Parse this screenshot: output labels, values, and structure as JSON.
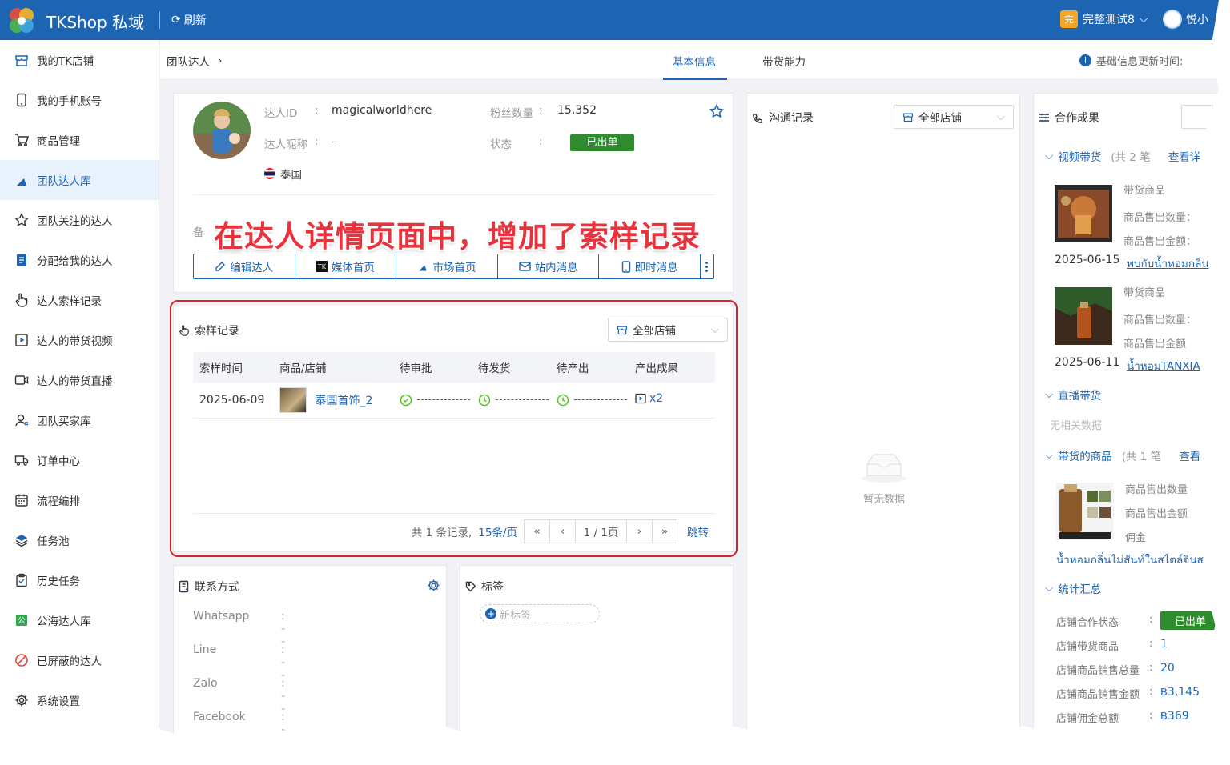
{
  "app": {
    "title": "TKShop 私域",
    "refresh": "刷新",
    "team": "完整测试8",
    "team_badge": "完",
    "user": "悦小"
  },
  "sidebar": {
    "items": [
      {
        "label": "我的TK店铺",
        "icon": "shop-icon"
      },
      {
        "label": "我的手机账号",
        "icon": "phone-icon"
      },
      {
        "label": "商品管理",
        "icon": "cart-icon"
      },
      {
        "label": "团队达人库",
        "icon": "creator-library-icon",
        "active": true
      },
      {
        "label": "团队关注的达人",
        "icon": "star-icon"
      },
      {
        "label": "分配给我的达人",
        "icon": "assigned-doc-icon"
      },
      {
        "label": "达人索样记录",
        "icon": "hand-pointer-icon"
      },
      {
        "label": "达人的带货视频",
        "icon": "video-play-icon"
      },
      {
        "label": "达人的带货直播",
        "icon": "live-camera-icon"
      },
      {
        "label": "团队买家库",
        "icon": "buyer-user-icon"
      },
      {
        "label": "订单中心",
        "icon": "truck-icon"
      },
      {
        "label": "流程编排",
        "icon": "calendar-icon"
      },
      {
        "label": "任务池",
        "icon": "layers-icon"
      },
      {
        "label": "历史任务",
        "icon": "clipboard-check-icon"
      },
      {
        "label": "公海达人库",
        "icon": "public-pool-icon"
      },
      {
        "label": "已屏蔽的达人",
        "icon": "blocked-icon"
      },
      {
        "label": "系统设置",
        "icon": "gear-icon"
      }
    ]
  },
  "header": {
    "breadcrumb": "团队达人",
    "tabs": [
      "基本信息",
      "带货能力"
    ],
    "update_label": "基础信息更新时间:"
  },
  "profile": {
    "id_label": "达人ID",
    "id_value": "magicalworldhere",
    "fans_label": "粉丝数量",
    "fans_value": "15,352",
    "nick_label": "达人昵称",
    "nick_value": "--",
    "status_label": "状态",
    "status_value": "已出单",
    "region": "泰国",
    "colon": ":",
    "note_prefix": "备",
    "actions": [
      "编辑达人",
      "媒体首页",
      "市场首页",
      "站内消息",
      "即时消息"
    ]
  },
  "annotation": "在达人详情页面中，增加了索样记录",
  "samples": {
    "title": "索样记录",
    "shop_filter": "全部店铺",
    "headers": [
      "索样时间",
      "商品/店铺",
      "待审批",
      "待发货",
      "待产出",
      "产出成果"
    ],
    "rows": [
      {
        "date": "2025-06-09",
        "shop": "泰国首饰_2",
        "output": "x2"
      }
    ],
    "total": "共 1 条记录,",
    "page_size": "15条/页",
    "page": "1 / 1页",
    "jump": "跳转"
  },
  "contact": {
    "title": "联系方式",
    "fields": [
      {
        "label": "Whatsapp",
        "value": "--"
      },
      {
        "label": "Line",
        "value": "--"
      },
      {
        "label": "Zalo",
        "value": "--"
      },
      {
        "label": "Facebook",
        "value": "--"
      }
    ]
  },
  "tags": {
    "title": "标签",
    "new_tag": "新标签"
  },
  "comm": {
    "title": "沟通记录",
    "shop_filter": "全部店铺",
    "empty": "暂无数据"
  },
  "coop": {
    "title": "合作成果",
    "video_group": "视频带货",
    "video_count": "(共 2 笔",
    "view_more": "查看详",
    "videos": [
      {
        "date": "2025-06-15",
        "link": "พบกับน้ำหอมกลิ่น",
        "l1": "带货商品",
        "l2": "商品售出数量：",
        "l3": "商品售出金额："
      },
      {
        "date": "2025-06-11",
        "link": "น้ำหอมTANXIA",
        "l1": "带货商品",
        "l2": "商品售出数量：",
        "l3": "商品售出金额"
      }
    ],
    "live_group": "直播带货",
    "live_empty": "无相关数据",
    "goods_group": "带货的商品",
    "goods_count": "(共 1 笔",
    "goods_more": "查看",
    "goods": {
      "l1": "商品售出数量",
      "l2": "商品售出金额",
      "l3": "佣金",
      "link": "น้ำหอมกลิ่นไม่สันท์ในสไตล์จีนส"
    },
    "stats_group": "统计汇总",
    "stats": [
      {
        "label": "店铺合作状态",
        "value": "已出单"
      },
      {
        "label": "店铺带货商品",
        "value": "1"
      },
      {
        "label": "店铺商品销售总量",
        "value": "20"
      },
      {
        "label": "店铺商品销售金额",
        "value": "฿3,145"
      },
      {
        "label": "店铺佣金总额",
        "value": "฿369"
      }
    ]
  },
  "colors": {
    "primary": "#1d64b3",
    "success": "#2e8b2e",
    "highlight": "#d8232a",
    "annotation": "#e8323c"
  }
}
